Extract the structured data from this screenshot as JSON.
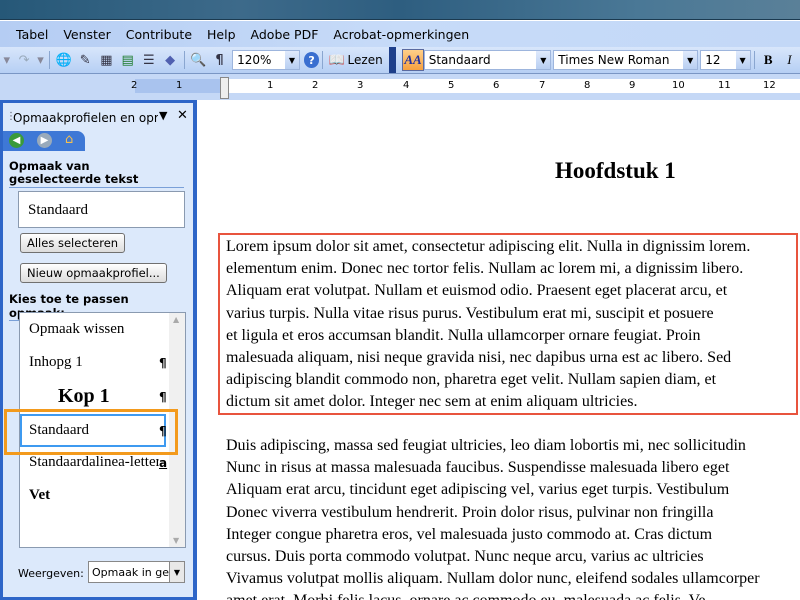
{
  "menu": [
    "Tabel",
    "Venster",
    "Contribute",
    "Help",
    "Adobe PDF",
    "Acrobat-opmerkingen"
  ],
  "toolbar": {
    "zoom": "120%",
    "read_label": "Lezen",
    "style": "Standaard",
    "font": "Times New Roman",
    "size": "12",
    "bold": "B",
    "italic": "I",
    "pilcrow": "¶"
  },
  "ruler": {
    "left": [
      "2",
      "1"
    ],
    "right": [
      "1",
      "2",
      "3",
      "4",
      "5",
      "6",
      "7",
      "8",
      "9",
      "10",
      "11",
      "12"
    ]
  },
  "pane": {
    "title": "Opmaakprofielen en opmaak",
    "selected_header": "Opmaak van geselecteerde tekst",
    "current_style": "Standaard",
    "select_all": "Alles selecteren",
    "new_style": "Nieuw opmaakprofiel...",
    "apply_header": "Kies toe te passen opmaak:",
    "styles": [
      {
        "label": "Opmaak wissen",
        "mark": ""
      },
      {
        "label": "Inhopg 1",
        "mark": "¶"
      },
      {
        "label": "Kop 1",
        "mark": "¶"
      },
      {
        "label": "Standaard",
        "mark": "¶"
      },
      {
        "label": "Standaardalinea-lettertype",
        "mark": "a"
      },
      {
        "label": "Vet",
        "mark": ""
      }
    ],
    "show_label": "Weergeven:",
    "show_value": "Opmaak in gebruik"
  },
  "colors": {
    "highlight_orange": "#f39a1c",
    "selection_red": "#e8543e",
    "pane_blue": "#2e66c8"
  },
  "document": {
    "heading": "Hoofdstuk 1",
    "para1": [
      "Lorem ipsum dolor sit amet, consectetur adipiscing elit. Nulla in dignissim lorem.",
      "elementum enim. Donec nec tortor felis. Nullam ac lorem mi, a dignissim libero.",
      "Aliquam erat volutpat. Nullam et euismod odio. Praesent eget placerat arcu, et",
      "varius turpis. Nulla vitae risus purus. Vestibulum erat mi, suscipit et posuere",
      "et ligula et eros accumsan blandit. Nulla ullamcorper ornare feugiat. Proin",
      "malesuada aliquam, nisi neque gravida nisi, nec dapibus urna est ac libero. Sed",
      "adipiscing blandit commodo non, pharetra eget velit. Nullam sapien diam, et",
      "dictum sit amet dolor. Integer nec sem at enim aliquam ultricies."
    ],
    "para2": [
      "Duis adipiscing, massa sed feugiat ultricies, leo diam lobortis mi, nec sollicitudin",
      "Nunc in risus at massa malesuada faucibus. Suspendisse malesuada libero eget",
      "Aliquam erat arcu, tincidunt eget adipiscing vel, varius eget turpis. Vestibulum",
      "Donec viverra vestibulum hendrerit. Proin dolor risus, pulvinar non fringilla",
      "Integer congue pharetra eros, vel malesuada justo commodo at. Cras dictum",
      "cursus. Duis porta commodo volutpat. Nunc neque arcu, varius ac ultricies",
      "Vivamus volutpat mollis aliquam. Nullam dolor nunc, eleifend sodales ullamcorper",
      "amet erat. Morbi felis lacus, ornare ac commodo eu, malesuada ac felis. Ve"
    ]
  }
}
